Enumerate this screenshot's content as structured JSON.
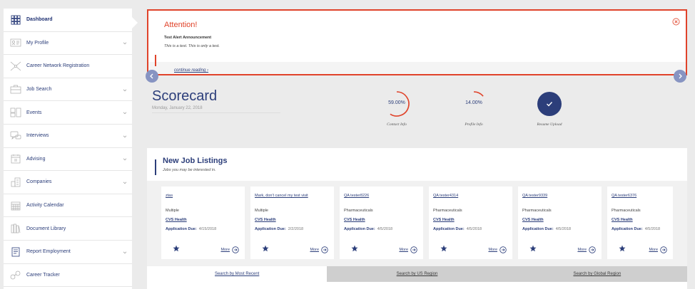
{
  "sidebar": {
    "items": [
      {
        "label": "Dashboard",
        "icon": "dashboard-grid-icon",
        "active": true,
        "chevron": false
      },
      {
        "label": "My Profile",
        "icon": "profile-card-icon",
        "active": false,
        "chevron": true
      },
      {
        "label": "Career Network Registration",
        "icon": "network-icon",
        "active": false,
        "chevron": false
      },
      {
        "label": "Job Search",
        "icon": "briefcase-icon",
        "active": false,
        "chevron": true
      },
      {
        "label": "Events",
        "icon": "events-icon",
        "active": false,
        "chevron": true
      },
      {
        "label": "Interviews",
        "icon": "interviews-icon",
        "active": false,
        "chevron": true
      },
      {
        "label": "Advising",
        "icon": "calendar-icon",
        "active": false,
        "chevron": true
      },
      {
        "label": "Companies",
        "icon": "companies-icon",
        "active": false,
        "chevron": true
      },
      {
        "label": "Activity Calendar",
        "icon": "activity-calendar-icon",
        "active": false,
        "chevron": false
      },
      {
        "label": "Document Library",
        "icon": "library-icon",
        "active": false,
        "chevron": false
      },
      {
        "label": "Report Employment",
        "icon": "report-icon",
        "active": false,
        "chevron": true
      },
      {
        "label": "Career Tracker",
        "icon": "tracker-icon",
        "active": false,
        "chevron": false
      }
    ]
  },
  "alert": {
    "title": "Attention!",
    "subtitle": "Test Alert Announcement",
    "body": "This is a test. This is only a test.",
    "link": "continue reading ›"
  },
  "scorecard": {
    "title": "Scorecard",
    "date": "Monday, January 22, 2018",
    "gauges": [
      {
        "value": "59.00%",
        "label": "Contact Info",
        "percent": 59
      },
      {
        "value": "14.00%",
        "label": "Profile Info",
        "percent": 14
      },
      {
        "value": "",
        "label": "Resume Upload",
        "percent": 100
      }
    ]
  },
  "jobs": {
    "title": "New Job Listings",
    "subtitle": "Jobs you may be interested in.",
    "due_label": "Application Due:",
    "more_label": "More",
    "cards": [
      {
        "title": "ztas",
        "industry": "Multiple",
        "company": "CVS Health",
        "due": "4/15/2018"
      },
      {
        "title": "Mark, don't cancel my test visit",
        "industry": "Multiple",
        "company": "CVS Health",
        "due": "2/2/2018"
      },
      {
        "title": "QA tester8226",
        "industry": "Pharmaceuticals",
        "company": "CVS Health",
        "due": "4/5/2018"
      },
      {
        "title": "QA tester4314",
        "industry": "Pharmaceuticals",
        "company": "CVS Health",
        "due": "4/5/2018"
      },
      {
        "title": "QA tester9339",
        "industry": "Pharmaceuticals",
        "company": "CVS Health",
        "due": "4/5/2018"
      },
      {
        "title": "QA tester6376",
        "industry": "Pharmaceuticals",
        "company": "CVS Health",
        "due": "4/5/2018"
      }
    ],
    "tabs": [
      {
        "label": "Search by Most Recent",
        "active": true
      },
      {
        "label": "Search by US Region",
        "active": false
      },
      {
        "label": "Search by Global Region",
        "active": false
      }
    ]
  },
  "colors": {
    "brand": "#2c3e7a",
    "alert": "#e0432a",
    "gauge_red": "#e0432a",
    "gauge_fill": "#2c3e7a"
  }
}
